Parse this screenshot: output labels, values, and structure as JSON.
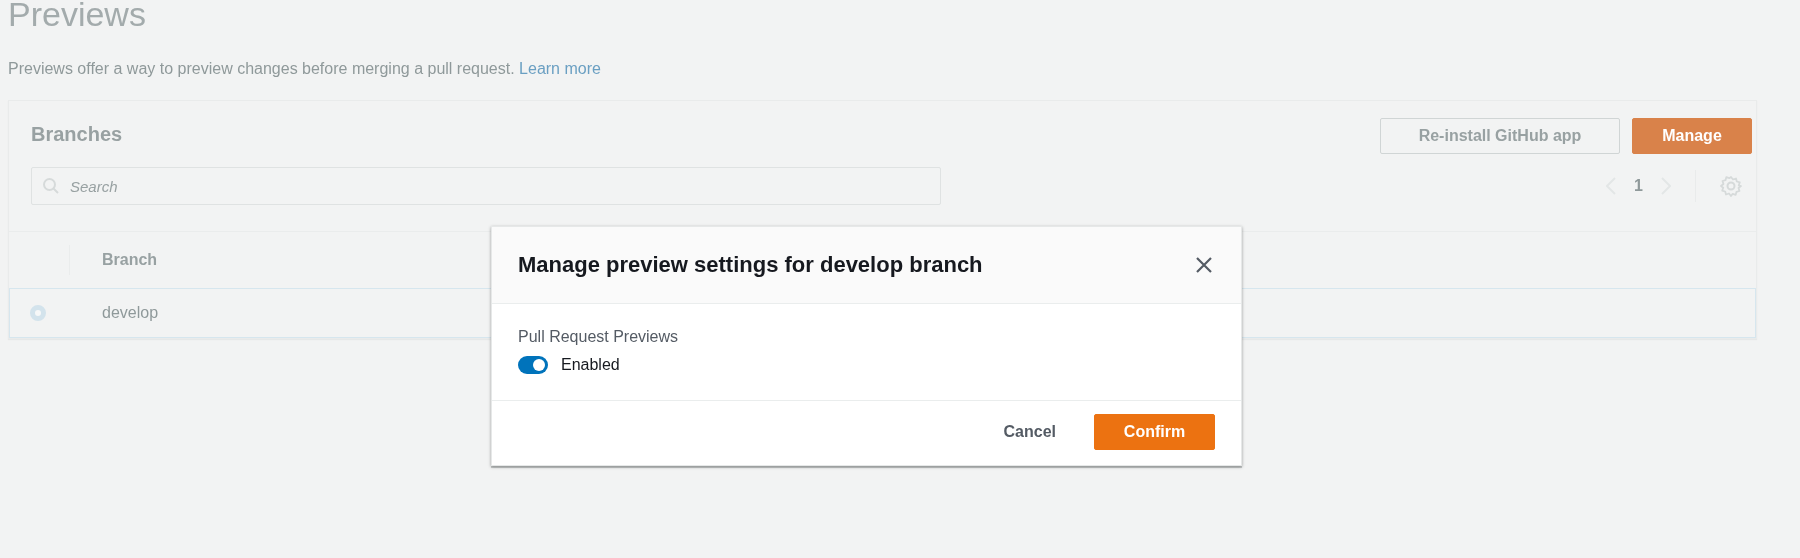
{
  "page": {
    "title": "Previews",
    "description": "Previews offer a way to preview changes before merging a pull request.",
    "learn_more_link": "Learn more"
  },
  "branches_panel": {
    "title": "Branches",
    "buttons": [
      {
        "label": "Re-install GitHub app",
        "kind": "secondary"
      },
      {
        "label": "Manage",
        "kind": "primary"
      }
    ],
    "search": {
      "placeholder": "Search"
    },
    "pagination": {
      "page": "1"
    },
    "table": {
      "columns": [
        "Branch"
      ],
      "rows": [
        {
          "branch": "develop",
          "selected": true
        }
      ]
    }
  },
  "modal": {
    "title": "Manage preview settings for develop branch",
    "setting_label": "Pull Request Previews",
    "toggle": {
      "label": "Enabled",
      "on": true
    },
    "buttons": [
      {
        "label": "Cancel",
        "kind": "link"
      },
      {
        "label": "Confirm",
        "kind": "primary"
      }
    ]
  }
}
